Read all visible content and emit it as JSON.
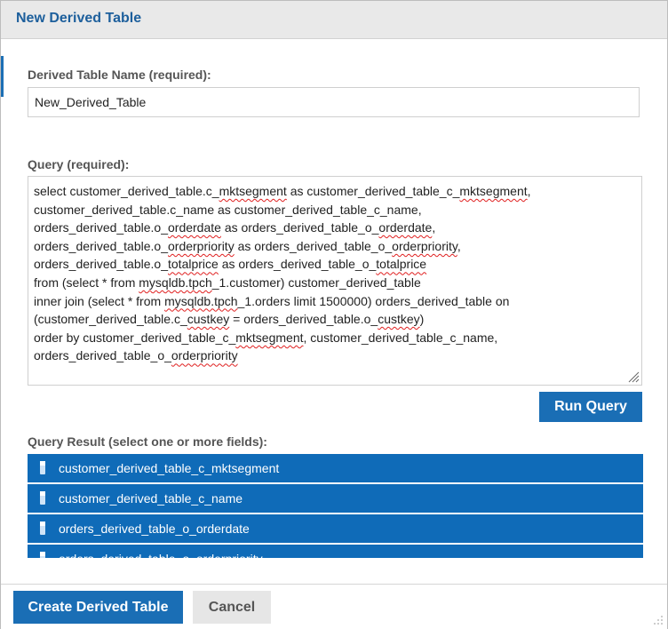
{
  "dialog": {
    "title": "New Derived Table"
  },
  "name_field": {
    "label": "Derived Table Name (required):",
    "value": "New_Derived_Table"
  },
  "query_field": {
    "label": "Query (required):",
    "lines": [
      "select customer_derived_table.c_mktsegment as customer_derived_table_c_mktsegment,",
      "customer_derived_table.c_name as customer_derived_table_c_name,",
      "orders_derived_table.o_orderdate as orders_derived_table_o_orderdate,",
      "orders_derived_table.o_orderpriority as orders_derived_table_o_orderpriority,",
      "orders_derived_table.o_totalprice as orders_derived_table_o_totalprice",
      "from (select * from mysqldb.tpch_1.customer) customer_derived_table",
      "inner join (select * from mysqldb.tpch_1.orders limit 1500000) orders_derived_table on",
      "(customer_derived_table.c_custkey = orders_derived_table.o_custkey)",
      "order by customer_derived_table_c_mktsegment, customer_derived_table_c_name,",
      "orders_derived_table_o_orderpriority"
    ]
  },
  "run_query_button": "Run Query",
  "result": {
    "label": "Query Result (select one or more fields):",
    "items": [
      "customer_derived_table_c_mktsegment",
      "customer_derived_table_c_name",
      "orders_derived_table_o_orderdate",
      "orders_derived_table_o_orderpriority"
    ]
  },
  "footer": {
    "create_label": "Create Derived Table",
    "cancel_label": "Cancel"
  },
  "colors": {
    "title": "#1d5f9c",
    "primary_button": "#1a6eb5",
    "result_item": "#0f6bb8",
    "spellcheck": "#e02020"
  },
  "icons": [
    "field-icon",
    "resize-grip-icon"
  ]
}
